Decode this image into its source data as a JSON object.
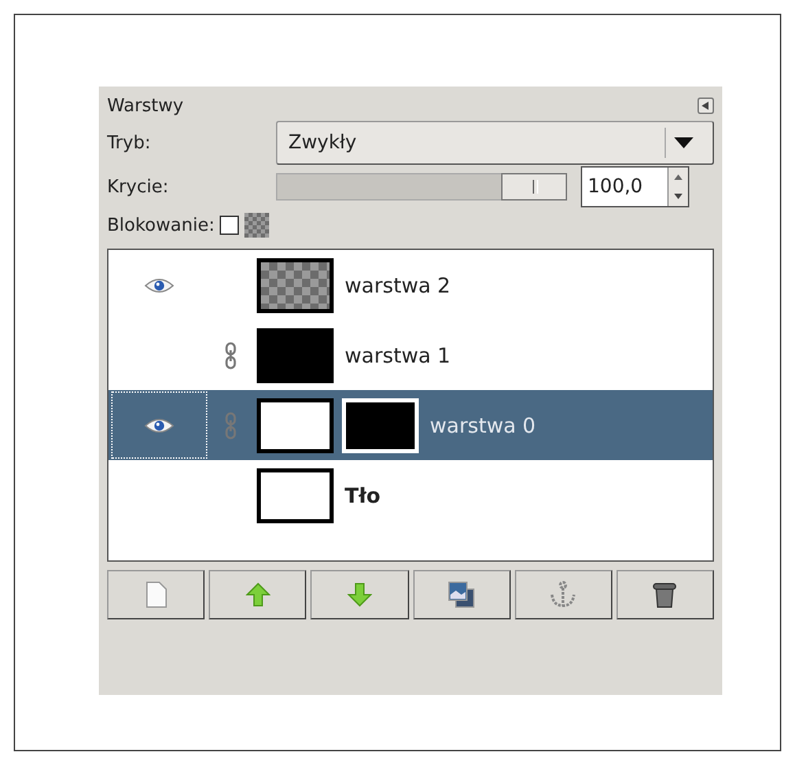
{
  "panel": {
    "title": "Warstwy"
  },
  "mode": {
    "label": "Tryb:",
    "value": "Zwykły"
  },
  "opacity": {
    "label": "Krycie:",
    "level": 1.0,
    "reading": "100,0"
  },
  "lock": {
    "label": "Blokowanie:",
    "checked": false
  },
  "layers": [
    {
      "name": "warstwa 2",
      "visible": true,
      "linked": false,
      "selected": false,
      "thumb": {
        "transparent": true
      },
      "bold": false
    },
    {
      "name": "warstwa 1",
      "visible": false,
      "linked": true,
      "selected": false,
      "thumb": {
        "color": "#000000"
      },
      "bold": false
    },
    {
      "name": "warstwa 0",
      "visible": true,
      "linked": true,
      "selected": true,
      "thumb": {
        "color": "#ffffff"
      },
      "mask": {
        "color": "#000000"
      },
      "bold": false
    },
    {
      "name": "Tło",
      "visible": false,
      "linked": false,
      "selected": false,
      "thumb": {
        "color": "#ffffff"
      },
      "bold": true
    }
  ],
  "buttons": [
    {
      "kind": "new"
    },
    {
      "kind": "raise"
    },
    {
      "kind": "lower"
    },
    {
      "kind": "duplicate"
    },
    {
      "kind": "anchor"
    },
    {
      "kind": "delete"
    }
  ]
}
